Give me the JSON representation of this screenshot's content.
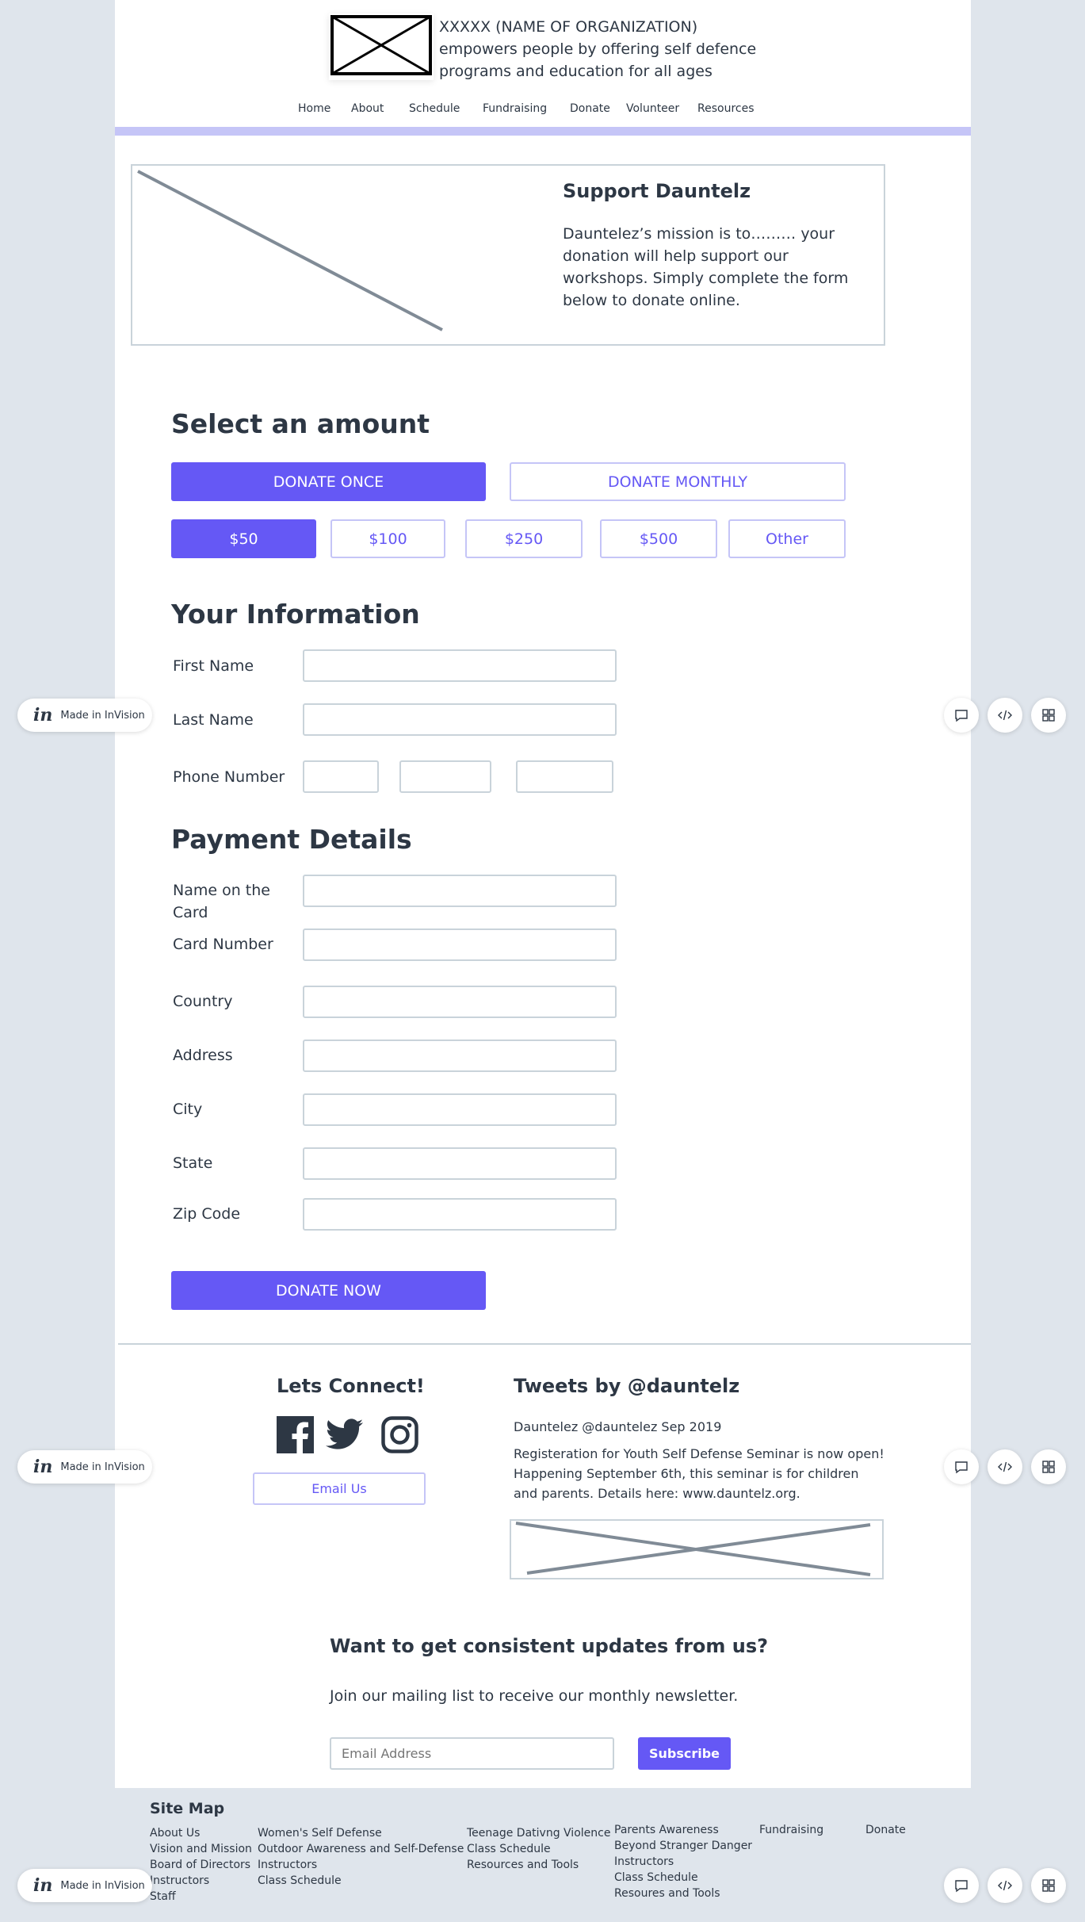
{
  "header": {
    "org_line1": "XXXXX (NAME OF ORGANIZATION)",
    "org_line2": "empowers people by offering self defence",
    "org_line3": "programs and education for all ages",
    "nav": [
      "Home",
      "About",
      "Schedule",
      "Fundraising",
      "Donate",
      "Volunteer",
      "Resources"
    ]
  },
  "hero": {
    "title": "Support Dauntelz",
    "body": "Dauntelez’s mission is to……… your donation will help support our workshops. Simply  complete the form below to donate online."
  },
  "amount": {
    "title": "Select an amount",
    "donate_once": "DONATE ONCE",
    "donate_monthly": "DONATE MONTHLY",
    "options": [
      "$50",
      "$100",
      "$250",
      "$500",
      "Other"
    ],
    "selected": "$50"
  },
  "info": {
    "title": "Your Information",
    "first_name": "First Name",
    "last_name": "Last Name",
    "phone": "Phone Number"
  },
  "payment": {
    "title": "Payment Details",
    "name_on_card": "Name on the Card",
    "card_number": "Card Number",
    "country": "Country",
    "address": "Address",
    "city": "City",
    "state": "State",
    "zip": "Zip Code",
    "donate_now": "DONATE NOW"
  },
  "connect": {
    "title": "Lets Connect!",
    "email_us": "Email Us"
  },
  "tweets": {
    "title": "Tweets by @dauntelz",
    "meta": "Dauntelez @dauntelez Sep 2019",
    "text": "Registeration for Youth Self Defense Seminar is now open! Happening September 6th, this seminar is for children and parents. Details here: www.dauntelz.org."
  },
  "newsletter": {
    "title": "Want to get consistent updates from us?",
    "body": "Join our mailing list to receive our monthly newsletter.",
    "email_placeholder": "Email Address",
    "subscribe": "Subscribe"
  },
  "sitemap": {
    "title": "Site Map",
    "col1": [
      "About Us",
      "Vision and Mission",
      "Board of Directors",
      "Instructors",
      "Staff"
    ],
    "col2": [
      "Women's Self Defense",
      "Outdoor Awareness and Self-Defense",
      "Instructors",
      "Class Schedule"
    ],
    "col3": [
      "Teenage Dativng Violence",
      "Class Schedule",
      "Resources and Tools"
    ],
    "col4": [
      "Parents Awareness",
      "Beyond Stranger Danger",
      "Instructors",
      "Class Schedule",
      "Resoures and Tools"
    ],
    "col5": [
      "Fundraising"
    ],
    "col6": [
      "Donate"
    ]
  },
  "invision": {
    "badge": "Made in InVision",
    "logo": "in"
  },
  "colors": {
    "accent": "#6558f5",
    "accent_light": "#c5c5f7",
    "text": "#2d3744",
    "border": "#c9d3da",
    "background": "#dfe5ec"
  }
}
